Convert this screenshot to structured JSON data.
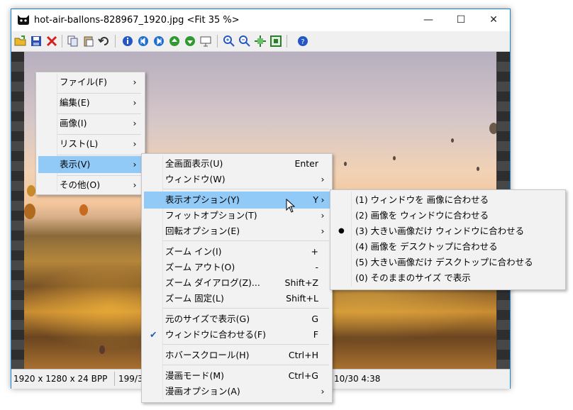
{
  "window": {
    "title": "hot-air-ballons-828967_1920.jpg <Fit 35 %>",
    "minimize": "—",
    "maximize": "☐",
    "close": "✕"
  },
  "toolbar": {
    "icons": [
      "open-folder-icon",
      "save-icon",
      "delete-icon",
      "copy-icon",
      "paste-icon",
      "undo-icon",
      "info-icon",
      "first-icon",
      "last-icon",
      "prev-icon",
      "next-icon",
      "slideshow-icon",
      "zoom-in-icon",
      "zoom-out-icon",
      "fit-icon",
      "fullscreen-icon",
      "help-icon"
    ]
  },
  "status": {
    "dims": "1920 x 1280 x 24 BPP",
    "index": "199/3",
    "time": "10/30 4:38"
  },
  "menu1": [
    {
      "label": "ファイル(F)",
      "arrow": "›"
    },
    {
      "label": "編集(E)",
      "arrow": "›"
    },
    {
      "label": "画像(I)",
      "arrow": "›"
    },
    {
      "label": "リスト(L)",
      "arrow": "›"
    },
    {
      "label": "表示(V)",
      "arrow": "›"
    },
    {
      "label": "その他(O)",
      "arrow": "›"
    }
  ],
  "menu2": [
    {
      "label": "全画面表示(U)",
      "shortcut": "Enter"
    },
    {
      "label": "ウィンドウ(W)",
      "arrow": "›"
    },
    {
      "label": "表示オプション(Y)",
      "shortcut": "Y",
      "arrow": "›"
    },
    {
      "label": "フィットオプション(T)",
      "arrow": "›"
    },
    {
      "label": "回転オプション(E)",
      "arrow": "›"
    },
    {
      "label": "ズーム イン(I)",
      "shortcut": "+"
    },
    {
      "label": "ズーム アウト(O)",
      "shortcut": "-"
    },
    {
      "label": "ズーム ダイアログ(Z)...",
      "shortcut": "Shift+Z"
    },
    {
      "label": "ズーム 固定(L)",
      "shortcut": "Shift+L"
    },
    {
      "label": "元のサイズで表示(G)",
      "shortcut": "G"
    },
    {
      "label": "ウィンドウに合わせる(F)",
      "shortcut": "F",
      "check": "✔"
    },
    {
      "label": "ホバースクロール(H)",
      "shortcut": "Ctrl+H"
    },
    {
      "label": "漫画モード(M)",
      "shortcut": "Ctrl+G"
    },
    {
      "label": "漫画オプション(A)",
      "arrow": "›"
    }
  ],
  "menu3": [
    {
      "label": "(1) ウィンドウを 画像に合わせる"
    },
    {
      "label": "(2) 画像を ウィンドウに合わせる"
    },
    {
      "label": "(3) 大きい画像だけ ウィンドウに合わせる",
      "bullet": "●"
    },
    {
      "label": "(4) 画像を デスクトップに合わせる"
    },
    {
      "label": "(5) 大きい画像だけ デスクトップに合わせる"
    },
    {
      "label": "(0) そのままのサイズ で表示"
    }
  ]
}
